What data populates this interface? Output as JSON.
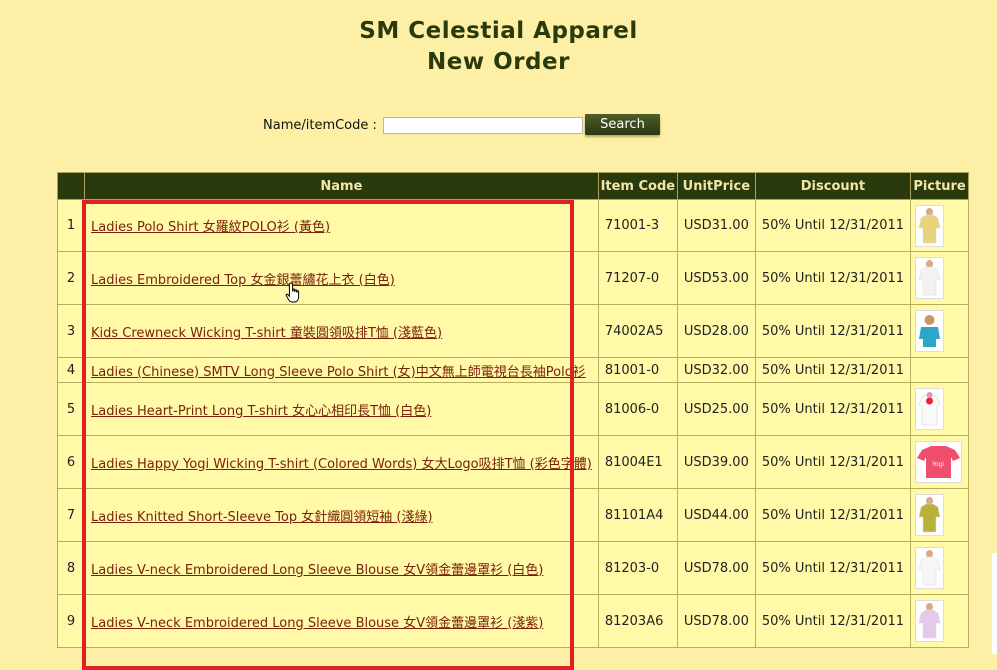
{
  "header": {
    "title_line1": "SM Celestial Apparel",
    "title_line2": "New Order"
  },
  "search": {
    "label": "Name/itemCode :",
    "value": "",
    "button": "Search"
  },
  "table": {
    "headers": [
      "",
      "Name",
      "Item Code",
      "UnitPrice",
      "Discount",
      "Picture"
    ],
    "rows": [
      {
        "no": "1",
        "name": "Ladies Polo Shirt 女羅紋POLO衫 (黃色)",
        "code": "71001-3",
        "price": "USD31.00",
        "discount": "50% Until 12/31/2011",
        "picture": "yellow-polo-image"
      },
      {
        "no": "2",
        "name": "Ladies Embroidered Top 女金銀蕾繡花上衣 (白色)",
        "code": "71207-0",
        "price": "USD53.00",
        "discount": "50% Until 12/31/2011",
        "picture": "white-top-image"
      },
      {
        "no": "3",
        "name": "Kids Crewneck Wicking T-shirt 童裝圓領吸排T恤 (淺藍色)",
        "code": "74002A5",
        "price": "USD28.00",
        "discount": "50% Until 12/31/2011",
        "picture": "kids-tshirt-image"
      },
      {
        "no": "4",
        "name": "Ladies (Chinese) SMTV Long Sleeve Polo Shirt (女)中文無上師電視台長袖Polo衫",
        "code": "81001-0",
        "price": "USD32.00",
        "discount": "50% Until 12/31/2011",
        "picture": ""
      },
      {
        "no": "5",
        "name": "Ladies Heart-Print Long T-shirt 女心心相印長T恤 (白色)",
        "code": "81006-0",
        "price": "USD25.00",
        "discount": "50% Until 12/31/2011",
        "picture": "heart-tshirt-image"
      },
      {
        "no": "6",
        "name": "Ladies Happy Yogi Wicking T-shirt (Colored Words) 女大Logo吸排T恤 (彩色字體)",
        "code": "81004E1",
        "price": "USD39.00",
        "discount": "50% Until 12/31/2011",
        "picture": "pink-tshirt-image"
      },
      {
        "no": "7",
        "name": "Ladies Knitted Short-Sleeve Top 女針織圓領短袖 (淺綠)",
        "code": "81101A4",
        "price": "USD44.00",
        "discount": "50% Until 12/31/2011",
        "picture": "green-top-image"
      },
      {
        "no": "8",
        "name": "Ladies V-neck Embroidered Long Sleeve Blouse 女V領金蕾邊罩衫 (白色)",
        "code": "81203-0",
        "price": "USD78.00",
        "discount": "50% Until 12/31/2011",
        "picture": "white-blouse-image"
      },
      {
        "no": "9",
        "name": "Ladies V-neck Embroidered Long Sleeve Blouse 女V領金蕾邊罩衫 (淺紫)",
        "code": "81203A6",
        "price": "USD78.00",
        "discount": "50% Until 12/31/2011",
        "picture": "purple-blouse-image"
      }
    ]
  },
  "colors": {
    "background": "#fdf0a6",
    "header_bg": "#2b3a0c",
    "highlight": "#e02025",
    "link": "#7a1f0a"
  }
}
